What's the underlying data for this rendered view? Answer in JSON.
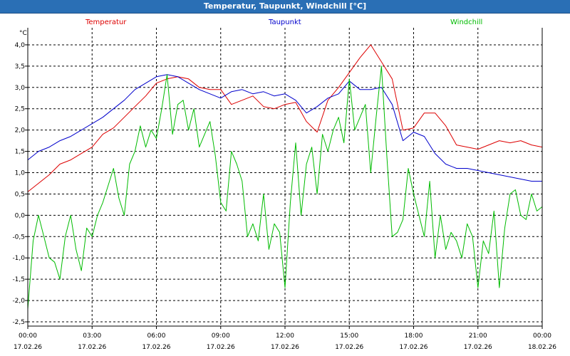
{
  "window": {
    "title": "Temperatur, Taupunkt, Windchill [°C]"
  },
  "colors": {
    "temperatur": "#dd0000",
    "taupunkt": "#0000cc",
    "windchill": "#00bb00",
    "grid": "#000000"
  },
  "chart_data": {
    "type": "line",
    "title": "Temperatur, Taupunkt, Windchill [°C]",
    "ylabel": "°C",
    "ylim": [
      -2.6,
      4.4
    ],
    "yticks": [
      "-2,5",
      "-2,0",
      "-1,5",
      "-1,0",
      "-0,5",
      "0,0",
      "0,5",
      "1,0",
      "1,5",
      "2,0",
      "2,5",
      "3,0",
      "3,5",
      "4,0"
    ],
    "ytick_values": [
      -2.5,
      -2.0,
      -1.5,
      -1.0,
      -0.5,
      0.0,
      0.5,
      1.0,
      1.5,
      2.0,
      2.5,
      3.0,
      3.5,
      4.0
    ],
    "xlim": [
      0,
      24
    ],
    "xticks": [
      {
        "t": 0,
        "time": "00:00",
        "date": "17.02.26"
      },
      {
        "t": 3,
        "time": "03:00",
        "date": "17.02.26"
      },
      {
        "t": 6,
        "time": "06:00",
        "date": "17.02.26"
      },
      {
        "t": 9,
        "time": "09:00",
        "date": "17.02.26"
      },
      {
        "t": 12,
        "time": "12:00",
        "date": "17.02.26"
      },
      {
        "t": 15,
        "time": "15:00",
        "date": "17.02.26"
      },
      {
        "t": 18,
        "time": "18:00",
        "date": "17.02.26"
      },
      {
        "t": 21,
        "time": "21:00",
        "date": "17.02.26"
      },
      {
        "t": 24,
        "time": "00:00",
        "date": "18.02.26"
      }
    ],
    "grid": true,
    "series": [
      {
        "name": "Temperatur",
        "x": [
          0,
          0.5,
          1,
          1.5,
          2,
          2.5,
          3,
          3.5,
          4,
          4.5,
          5,
          5.5,
          6,
          6.5,
          7,
          7.5,
          8,
          8.5,
          9,
          9.5,
          10,
          10.5,
          11,
          11.5,
          12,
          12.5,
          13,
          13.5,
          14,
          14.5,
          15,
          15.5,
          16,
          16.5,
          17,
          17.5,
          18,
          18.5,
          19,
          19.5,
          20,
          20.5,
          21,
          21.5,
          22,
          22.5,
          23,
          23.5,
          24
        ],
        "y": [
          0.55,
          0.75,
          0.95,
          1.2,
          1.3,
          1.45,
          1.6,
          1.9,
          2.05,
          2.3,
          2.55,
          2.8,
          3.1,
          3.2,
          3.25,
          3.2,
          3.0,
          2.95,
          2.95,
          2.6,
          2.7,
          2.8,
          2.55,
          2.5,
          2.6,
          2.65,
          2.2,
          1.95,
          2.7,
          3.0,
          3.35,
          3.7,
          4.0,
          3.6,
          3.2,
          2.0,
          2.05,
          2.4,
          2.4,
          2.1,
          1.65,
          1.6,
          1.55,
          1.65,
          1.75,
          1.7,
          1.75,
          1.65,
          1.6
        ]
      },
      {
        "name": "Taupunkt",
        "x": [
          0,
          0.5,
          1,
          1.5,
          2,
          2.5,
          3,
          3.5,
          4,
          4.5,
          5,
          5.5,
          6,
          6.5,
          7,
          7.5,
          8,
          8.5,
          9,
          9.5,
          10,
          10.5,
          11,
          11.5,
          12,
          12.5,
          13,
          13.5,
          14,
          14.5,
          15,
          15.5,
          16,
          16.5,
          17,
          17.5,
          18,
          18.5,
          19,
          19.5,
          20,
          20.5,
          21,
          21.5,
          22,
          22.5,
          23,
          23.5,
          24
        ],
        "y": [
          1.3,
          1.5,
          1.6,
          1.75,
          1.85,
          2.0,
          2.15,
          2.3,
          2.5,
          2.7,
          2.95,
          3.1,
          3.25,
          3.3,
          3.25,
          3.1,
          2.95,
          2.85,
          2.75,
          2.9,
          2.95,
          2.85,
          2.9,
          2.8,
          2.85,
          2.7,
          2.4,
          2.55,
          2.75,
          2.85,
          3.15,
          2.95,
          2.95,
          3.0,
          2.6,
          1.75,
          1.95,
          1.85,
          1.45,
          1.2,
          1.1,
          1.1,
          1.05,
          1.0,
          0.95,
          0.9,
          0.85,
          0.8,
          0.8
        ]
      },
      {
        "name": "Windchill",
        "x": [
          0,
          0.25,
          0.5,
          0.75,
          1,
          1.25,
          1.5,
          1.75,
          2,
          2.25,
          2.5,
          2.75,
          3,
          3.25,
          3.5,
          3.75,
          4,
          4.25,
          4.5,
          4.75,
          5,
          5.25,
          5.5,
          5.75,
          6,
          6.25,
          6.5,
          6.75,
          7,
          7.25,
          7.5,
          7.75,
          8,
          8.25,
          8.5,
          8.75,
          9,
          9.25,
          9.5,
          9.75,
          10,
          10.25,
          10.5,
          10.75,
          11,
          11.25,
          11.5,
          11.75,
          12,
          12.25,
          12.5,
          12.75,
          13,
          13.25,
          13.5,
          13.75,
          14,
          14.25,
          14.5,
          14.75,
          15,
          15.25,
          15.5,
          15.75,
          16,
          16.25,
          16.5,
          16.75,
          17,
          17.25,
          17.5,
          17.75,
          18,
          18.25,
          18.5,
          18.75,
          19,
          19.25,
          19.5,
          19.75,
          20,
          20.25,
          20.5,
          20.75,
          21,
          21.25,
          21.5,
          21.75,
          22,
          22.25,
          22.5,
          22.75,
          23,
          23.25,
          23.5,
          23.75,
          24
        ],
        "y": [
          -2.2,
          -0.6,
          0.0,
          -0.5,
          -1.0,
          -1.1,
          -1.5,
          -0.5,
          0.0,
          -0.8,
          -1.3,
          -0.3,
          -0.5,
          0.0,
          0.3,
          0.7,
          1.1,
          0.4,
          0.0,
          1.2,
          1.5,
          2.1,
          1.6,
          2.0,
          1.8,
          2.5,
          3.3,
          1.9,
          2.6,
          2.7,
          2.0,
          2.5,
          1.6,
          1.9,
          2.2,
          1.4,
          0.3,
          0.1,
          1.5,
          1.2,
          0.8,
          -0.5,
          -0.2,
          -0.6,
          0.5,
          -0.8,
          -0.2,
          -0.4,
          -1.7,
          0.3,
          1.7,
          0.0,
          1.2,
          1.6,
          0.5,
          1.9,
          1.5,
          2.0,
          2.3,
          1.7,
          3.2,
          2.0,
          2.3,
          2.6,
          1.0,
          2.3,
          3.5,
          1.4,
          -0.5,
          -0.4,
          -0.1,
          1.1,
          0.5,
          0.0,
          -0.5,
          0.8,
          -1.0,
          0.0,
          -0.8,
          -0.4,
          -0.6,
          -1.0,
          -0.2,
          -0.5,
          -1.7,
          -0.6,
          -0.9,
          0.1,
          -1.7,
          -0.3,
          0.5,
          0.6,
          0.0,
          -0.1,
          0.5,
          0.1,
          0.2
        ]
      }
    ]
  }
}
